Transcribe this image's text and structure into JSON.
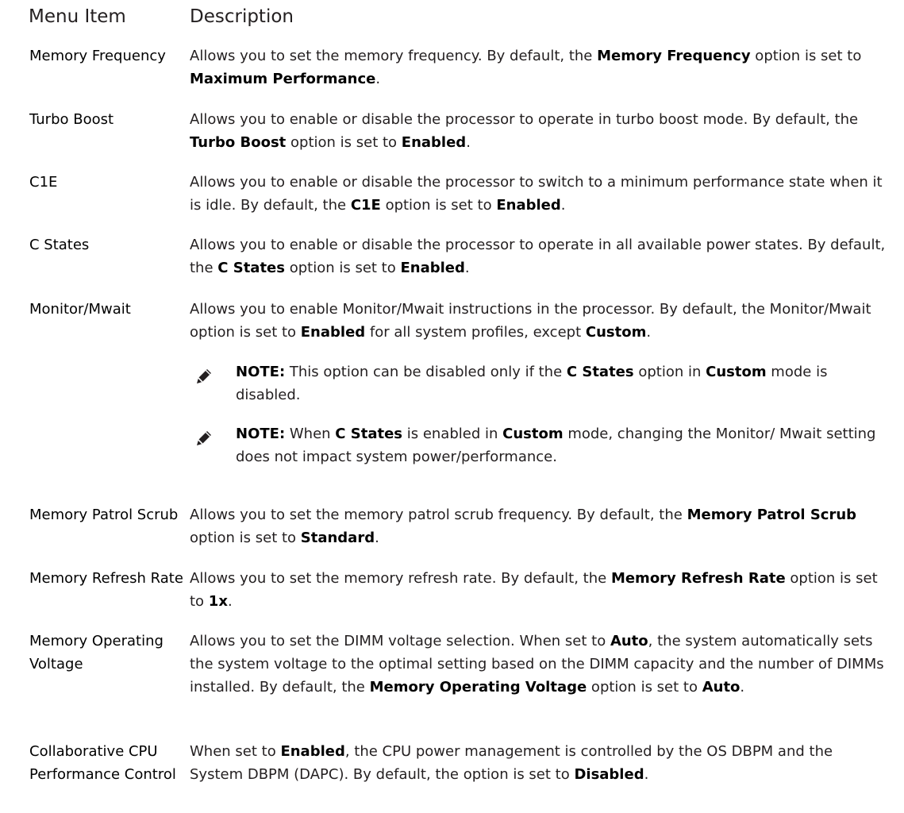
{
  "headers": {
    "menu_item": "Menu Item",
    "description": "Description"
  },
  "rows": [
    {
      "term": "Memory Frequency",
      "desc": [
        {
          "t": "Allows you to set the memory frequency. By default, the "
        },
        {
          "b": "Memory Frequency"
        },
        {
          "t": " option is set to "
        },
        {
          "b": "Maximum Performance"
        },
        {
          "t": "."
        }
      ]
    },
    {
      "term": "Turbo Boost",
      "desc": [
        {
          "t": "Allows you to enable or disable the processor to operate in turbo boost mode. By default, the "
        },
        {
          "b": "Turbo Boost"
        },
        {
          "t": " option is set to "
        },
        {
          "b": "Enabled"
        },
        {
          "t": "."
        }
      ]
    },
    {
      "term": "C1E",
      "desc": [
        {
          "t": "Allows you to enable or disable the processor to switch to a minimum performance state when it is idle. By default, the "
        },
        {
          "b": "C1E"
        },
        {
          "t": " option is set to "
        },
        {
          "b": "Enabled"
        },
        {
          "t": "."
        }
      ]
    },
    {
      "term": "C States",
      "desc": [
        {
          "t": "Allows you to enable or disable the processor to operate in all available power states. By default, the "
        },
        {
          "b": "C States"
        },
        {
          "t": " option is set to "
        },
        {
          "b": "Enabled"
        },
        {
          "t": "."
        }
      ]
    },
    {
      "term": "Monitor/Mwait",
      "desc": [
        {
          "t": "Allows you to enable Monitor/Mwait instructions in the processor. By default, the Monitor/Mwait option is set to "
        },
        {
          "b": "Enabled"
        },
        {
          "t": " for all system profiles, except "
        },
        {
          "b": "Custom"
        },
        {
          "t": "."
        }
      ]
    },
    {
      "term": "Memory Patrol Scrub",
      "desc": [
        {
          "t": "Allows you to set the memory patrol scrub frequency. By default, the "
        },
        {
          "b": "Memory Patrol Scrub"
        },
        {
          "t": " option is set to "
        },
        {
          "b": "Standard"
        },
        {
          "t": "."
        }
      ]
    },
    {
      "term": "Memory Refresh Rate",
      "desc": [
        {
          "t": "Allows you to set the memory refresh rate. By default, the "
        },
        {
          "b": "Memory Refresh Rate"
        },
        {
          "t": " option is set to "
        },
        {
          "b": "1x"
        },
        {
          "t": "."
        }
      ]
    },
    {
      "term": "Memory Operating Voltage",
      "desc": [
        {
          "t": "Allows you to set the DIMM voltage selection. When set to "
        },
        {
          "b": "Auto"
        },
        {
          "t": ", the system automatically sets the system voltage to the optimal setting based on the DIMM capacity and the number of DIMMs installed. By default, the "
        },
        {
          "b": "Memory Operating Voltage"
        },
        {
          "t": " option is set to "
        },
        {
          "b": "Auto"
        },
        {
          "t": "."
        }
      ]
    },
    {
      "term": "Collaborative CPU Performance Control",
      "desc": [
        {
          "t": "When set to "
        },
        {
          "b": "Enabled"
        },
        {
          "t": ", the CPU power management is controlled by the OS DBPM and the System DBPM (DAPC). By default, the option is set to "
        },
        {
          "b": "Disabled"
        },
        {
          "t": "."
        }
      ]
    }
  ],
  "notes": [
    {
      "label": "NOTE:",
      "text": [
        {
          "t": " This option can be disabled only if the "
        },
        {
          "b": "C States"
        },
        {
          "t": " option in "
        },
        {
          "b": "Custom"
        },
        {
          "t": " mode is disabled."
        }
      ]
    },
    {
      "label": "NOTE:",
      "text": [
        {
          "t": " When "
        },
        {
          "b": "C States"
        },
        {
          "t": " is enabled in "
        },
        {
          "b": "Custom"
        },
        {
          "t": " mode, changing the Monitor/ Mwait setting does not impact system power/performance."
        }
      ]
    }
  ]
}
